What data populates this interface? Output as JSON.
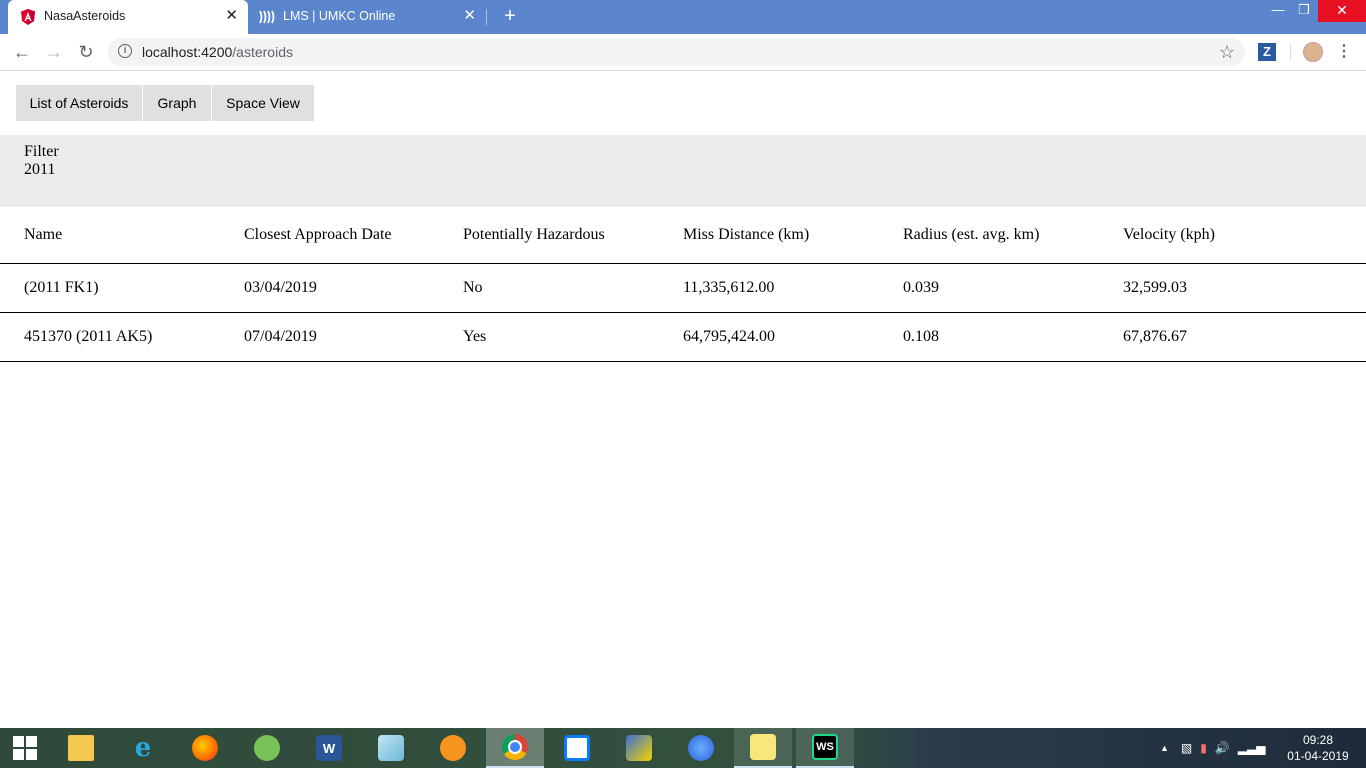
{
  "browser": {
    "tabs": [
      {
        "title": "NasaAsteroids",
        "active": true,
        "favicon": "angular-icon"
      },
      {
        "title": "LMS | UMKC Online",
        "active": false,
        "favicon": "umkc-icon"
      }
    ],
    "url": {
      "host": "localhost:4200",
      "path": "/asteroids"
    }
  },
  "app": {
    "nav": [
      "List of Asteroids",
      "Graph",
      "Space View"
    ],
    "filter": {
      "label": "Filter",
      "value": "2011"
    },
    "table": {
      "headers": [
        "Name",
        "Closest Approach Date",
        "Potentially Hazardous",
        "Miss Distance (km)",
        "Radius (est. avg. km)",
        "Velocity (kph)"
      ],
      "rows": [
        [
          "(2011 FK1)",
          "03/04/2019",
          "No",
          "11,335,612.00",
          "0.039",
          "32,599.03"
        ],
        [
          "451370 (2011 AK5)",
          "07/04/2019",
          "Yes",
          "64,795,424.00",
          "0.108",
          "67,876.67"
        ]
      ]
    }
  },
  "taskbar": {
    "apps": [
      "file-explorer-icon",
      "internet-explorer-icon",
      "firefox-icon",
      "android-studio-icon",
      "word-icon",
      "notes-icon",
      "settings-app-icon",
      "chrome-icon",
      "intellij-icon",
      "network-tool-icon",
      "firefox-dev-icon",
      "sticky-notes-icon",
      "webstorm-icon"
    ],
    "word_letter": "W",
    "webstorm_letters": "WS",
    "time": "09:28",
    "date": "01-04-2019"
  }
}
